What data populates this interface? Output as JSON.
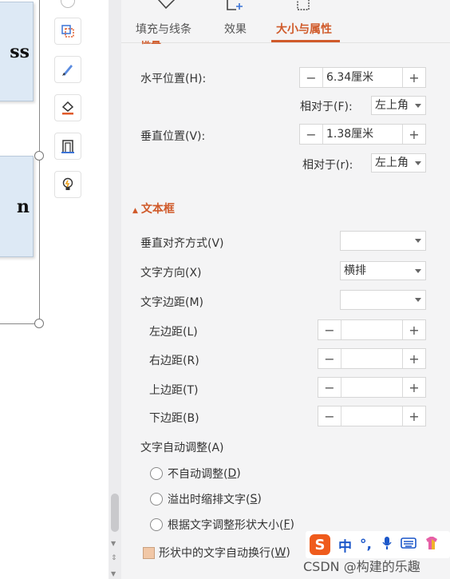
{
  "canvas": {
    "shape1_text": "ss",
    "shape2_text": "n"
  },
  "toolbar": {
    "tools": [
      "crop-icon",
      "pen-icon",
      "fill-icon",
      "frame-icon",
      "bulb-icon"
    ]
  },
  "tabs": [
    {
      "label": "填充与线条"
    },
    {
      "label": "效果"
    },
    {
      "label": "大小与属性"
    }
  ],
  "position_section": {
    "cut_label": "位置",
    "horizontal_label": "水平位置(H):",
    "horizontal_value": "6.34厘米",
    "horizontal_rel_label": "相对于(F):",
    "horizontal_rel_value": "左上角",
    "vertical_label": "垂直位置(V):",
    "vertical_value": "1.38厘米",
    "vertical_rel_label": "相对于(r):",
    "vertical_rel_value": "左上角"
  },
  "textbox": {
    "title": "文本框",
    "valign_label": "垂直对齐方式(V)",
    "valign_value": "",
    "direction_label": "文字方向(X)",
    "direction_value": "横排",
    "margin_label": "文字边距(M)",
    "margin_value": "",
    "left_label": "左边距(L)",
    "right_label": "右边距(R)",
    "top_label": "上边距(T)",
    "bottom_label": "下边距(B)",
    "autofit_label": "文字自动调整(A)",
    "opt1_text": "不自动调整(",
    "opt1_key": "D",
    "opt2_text": "溢出时缩排文字(",
    "opt2_key": "S",
    "opt3_text": "根据文字调整形状大小(",
    "opt3_key": "F",
    "wrap_text": "形状中的文字自动换行(",
    "wrap_key": "W"
  },
  "stepper_glyphs": {
    "minus": "−",
    "plus": "+"
  },
  "ime": {
    "logo": "S",
    "mode": "中",
    "punct": "°,"
  },
  "watermark": "CSDN @构建的乐趣",
  "colors": {
    "accent": "#d05a2a",
    "ime_logo": "#ef5b1c",
    "ime_icons": "#1c57c9"
  }
}
